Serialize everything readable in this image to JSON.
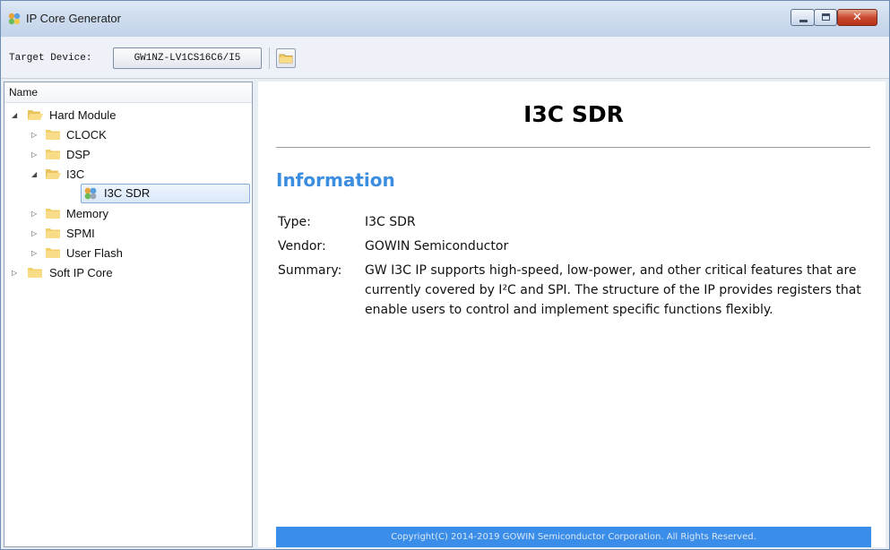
{
  "window": {
    "title": "IP Core Generator",
    "title_icon": "ip-core-generator-icon",
    "controls": {
      "minimize": "minimize",
      "maximize": "maximize",
      "close": "✕"
    }
  },
  "toolbar": {
    "target_label": "Target Device:",
    "device_value": "GW1NZ-LV1CS16C6/I5",
    "folder_icon": "folder-icon"
  },
  "tree": {
    "header": "Name",
    "items": [
      {
        "label": "Hard Module",
        "expanded": true
      },
      {
        "label": "CLOCK",
        "expanded": false
      },
      {
        "label": "DSP",
        "expanded": false
      },
      {
        "label": "I3C",
        "expanded": true
      },
      {
        "label": "I3C SDR",
        "selected": true
      },
      {
        "label": "Memory",
        "expanded": false
      },
      {
        "label": "SPMI",
        "expanded": false
      },
      {
        "label": "User Flash",
        "expanded": false
      },
      {
        "label": "Soft IP Core",
        "expanded": false
      }
    ]
  },
  "content": {
    "title": "I3C SDR",
    "info_heading": "Information",
    "type_key": "Type:",
    "type_value": "I3C SDR",
    "vendor_key": "Vendor:",
    "vendor_value": "GOWIN Semiconductor",
    "summary_key": "Summary:",
    "summary_value": "GW I3C IP supports high-speed, low-power, and other critical features that are currently covered by I²C and SPI. The structure of the IP provides registers that enable users to control and implement specific functions flexibly.",
    "footer": "Copyright(C) 2014-2019 GOWIN Semiconductor Corporation. All Rights Reserved."
  },
  "colors": {
    "accent_heading": "#3b8de0",
    "footer_bar": "#3a8de8",
    "folder": "#f3cf6c"
  }
}
